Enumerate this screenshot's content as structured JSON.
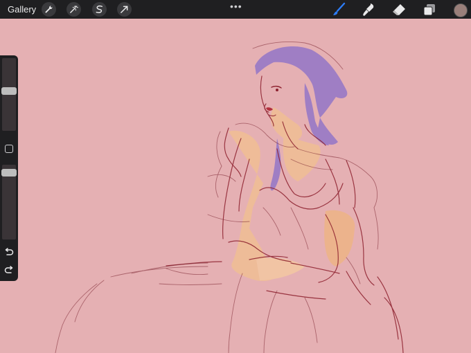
{
  "app": {
    "gallery_label": "Gallery"
  },
  "toolbar": {
    "left_tools": [
      "wrench-icon",
      "magic-wand-icon",
      "selection-icon",
      "move-arrow-icon"
    ],
    "more_label": "•••",
    "right_tools": [
      "brush-icon",
      "smudge-icon",
      "eraser-icon",
      "layers-icon"
    ],
    "active_tool": "brush-icon",
    "active_tool_color": "#2d7cf6",
    "current_color": "#9a7f7a"
  },
  "sidebar": {
    "brush_size_level": 0.45,
    "opacity_level": 0.06
  },
  "canvas": {
    "background_color": "#e5b0b3"
  }
}
